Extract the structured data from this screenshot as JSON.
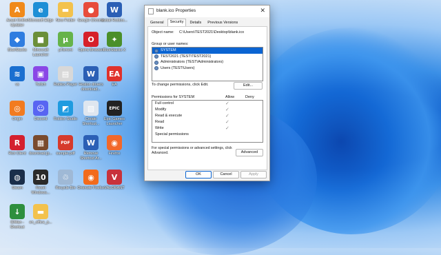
{
  "desktop_icons": [
    {
      "label": "Avast Online Updater",
      "color": "#f08a1c",
      "glyph": "A"
    },
    {
      "label": "Microsoft Edge",
      "color": "#1e8fd6",
      "glyph": "e"
    },
    {
      "label": "New Folder",
      "color": "#f3c24d",
      "glyph": "▬"
    },
    {
      "label": "Google Chrome",
      "color": "#e74c3c",
      "glyph": "●"
    },
    {
      "label": "Install Roblox...",
      "color": "#2b5fb5",
      "glyph": "W"
    },
    {
      "label": "BlueStacks",
      "color": "#2f7de0",
      "glyph": "◆"
    },
    {
      "label": "Minecraft Launcher",
      "color": "#6b8f3a",
      "glyph": "■"
    },
    {
      "label": "µTorrent",
      "color": "#66b34a",
      "glyph": "µ"
    },
    {
      "label": "Opera Browser",
      "color": "#d6202a",
      "glyph": "O"
    },
    {
      "label": "BlueStacks X",
      "color": "#4a8f2a",
      "glyph": "✦"
    },
    {
      "label": "vs",
      "color": "#1a6fd0",
      "glyph": "≋"
    },
    {
      "label": "Twitch",
      "color": "#8a47e6",
      "glyph": "▣"
    },
    {
      "label": "Roblox Player",
      "color": "#d8d8d8",
      "glyph": "▤"
    },
    {
      "label": "Hoston drivers download...",
      "color": "#2b5fb5",
      "glyph": "W"
    },
    {
      "label": "EA",
      "color": "#e0322c",
      "glyph": "EA"
    },
    {
      "label": "Origin",
      "color": "#f27b20",
      "glyph": "◎"
    },
    {
      "label": "Discord",
      "color": "#5865f2",
      "glyph": "☺"
    },
    {
      "label": "Roblox Studio",
      "color": "#1f9be0",
      "glyph": "◩"
    },
    {
      "label": "Create Shortcut...",
      "color": "#dfe6ef",
      "glyph": "▧"
    },
    {
      "label": "Epic Games Launcher",
      "color": "#222222",
      "glyph": "EPIC"
    },
    {
      "label": "Riot Client",
      "color": "#d4202f",
      "glyph": "R"
    },
    {
      "label": "download.jp...",
      "color": "#7a4b2e",
      "glyph": "▦"
    },
    {
      "label": "sample.pdf",
      "color": "#d63a2c",
      "glyph": "PDF"
    },
    {
      "label": "Remove Shortcut Ar...",
      "color": "#2b5fb5",
      "glyph": "W"
    },
    {
      "label": "Firefox",
      "color": "#f2682a",
      "glyph": "◉"
    },
    {
      "label": "Steam",
      "color": "#1a2e4a",
      "glyph": "◍"
    },
    {
      "label": "Reset Windows...",
      "color": "#2a2a2a",
      "glyph": "10"
    },
    {
      "label": "Recycle Bin",
      "color": "#9fb9d6",
      "glyph": "♲"
    },
    {
      "label": "Onenote Firefox",
      "color": "#f26b1c",
      "glyph": "◉"
    },
    {
      "label": "VALORANT",
      "color": "#c8323c",
      "glyph": "V"
    },
    {
      "label": "IDMan - Shortcut",
      "color": "#2e8f3e",
      "glyph": "↓"
    },
    {
      "label": "en_office_p...",
      "color": "#f3c24d",
      "glyph": "▬"
    }
  ],
  "dialog": {
    "title": "blank.ico Properties",
    "close_glyph": "✕",
    "tabs": [
      "General",
      "Security",
      "Details",
      "Previous Versions"
    ],
    "active_tab": "Security",
    "object_name_label": "Object name:",
    "object_name_value": "C:\\Users\\TEST2021\\Desktop\\blank.ico",
    "group_label": "Group or user names:",
    "users": [
      {
        "name": "SYSTEM",
        "selected": true
      },
      {
        "name": "TEST2021 (TEST\\TEST2021)",
        "selected": false
      },
      {
        "name": "Administrators (TEST\\Administrators)",
        "selected": false
      },
      {
        "name": "Users (TEST\\Users)",
        "selected": false
      }
    ],
    "change_hint": "To change permissions, click Edit.",
    "edit_button": "Edit...",
    "permissions_label": "Permissions for SYSTEM",
    "allow_label": "Allow",
    "deny_label": "Deny",
    "permissions": [
      {
        "name": "Full control",
        "allow": true
      },
      {
        "name": "Modify",
        "allow": true
      },
      {
        "name": "Read & execute",
        "allow": true
      },
      {
        "name": "Read",
        "allow": true
      },
      {
        "name": "Write",
        "allow": true
      },
      {
        "name": "Special permissions",
        "allow": false
      }
    ],
    "check_glyph": "✓",
    "advanced_hint": "For special permissions or advanced settings, click Advanced.",
    "advanced_button": "Advanced",
    "ok_button": "OK",
    "cancel_button": "Cancel",
    "apply_button": "Apply"
  }
}
